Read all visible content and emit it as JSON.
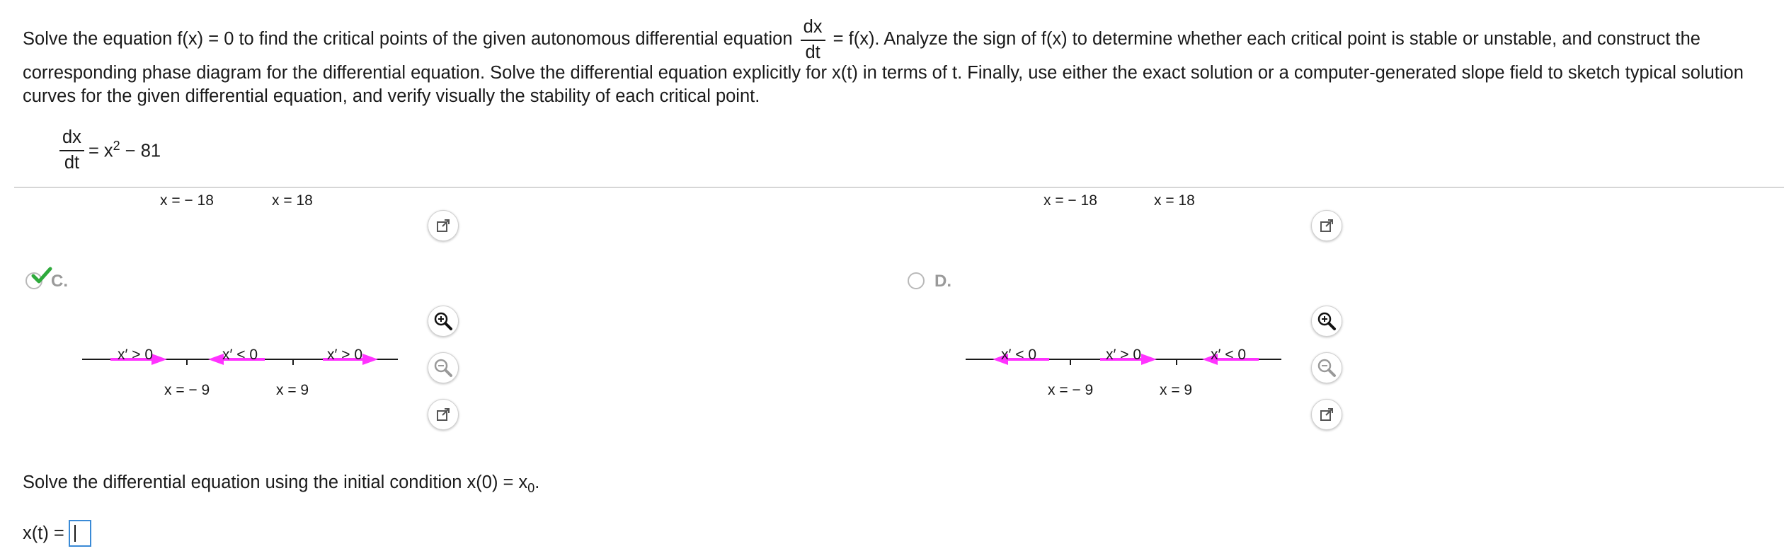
{
  "problem": {
    "text_1": "Solve the equation f(x) = 0 to find the critical points of the given autonomous differential equation",
    "frac_num": "dx",
    "frac_den": "dt",
    "text_2": "= f(x). Analyze the sign of f(x) to determine whether each critical point is stable or unstable, and construct the corresponding phase diagram for the differential equation. Solve the differential equation explicitly for x(t) in terms of t. Finally, use either the exact solution or a computer-generated slope field to sketch typical solution curves for the given differential equation, and verify visually the stability of each critical point."
  },
  "equation": {
    "num": "dx",
    "den": "dt",
    "rhs_prefix": "= x",
    "exponent": "2",
    "rhs_suffix": " − 81"
  },
  "options": {
    "A": {
      "tick_labels": [
        "x = − 18",
        "x = 18"
      ]
    },
    "B": {
      "tick_labels": [
        "x = − 18",
        "x = 18"
      ]
    },
    "C": {
      "letter": "C.",
      "selected": true,
      "region_labels": [
        "x′ > 0",
        "x′ < 0",
        "x′ > 0"
      ],
      "tick_labels": [
        "x = − 9",
        "x = 9"
      ],
      "arrows": [
        "right",
        "left",
        "right"
      ]
    },
    "D": {
      "letter": "D.",
      "selected": false,
      "region_labels": [
        "x′ < 0",
        "x′ > 0",
        "x′ < 0"
      ],
      "tick_labels": [
        "x = − 9",
        "x = 9"
      ],
      "arrows": [
        "left",
        "right",
        "left"
      ]
    }
  },
  "colors": {
    "arrow": "#ff33ff",
    "check": "#2eaa3c",
    "input_border": "#3a8ad6"
  },
  "icons": [
    "zoom-in-icon",
    "zoom-out-icon",
    "popout-icon",
    "check-icon"
  ],
  "followup": {
    "text": "Solve the differential equation using the initial condition x(0) = x",
    "subscript": "0",
    "end": "."
  },
  "answer": {
    "label": "x(t) =",
    "value": ""
  }
}
